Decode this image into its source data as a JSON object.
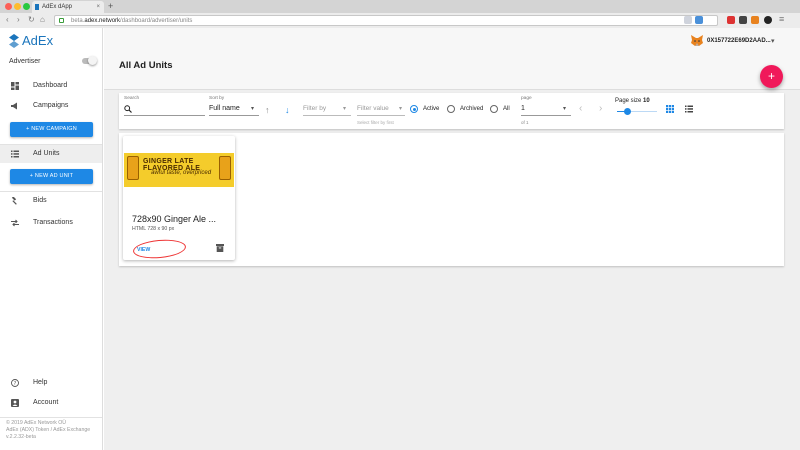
{
  "browser": {
    "tab_title": "AdEx dApp",
    "url_prefix": "beta.",
    "url_host": "adex.network",
    "url_path": "/dashboard/advertiser/units"
  },
  "sidebar": {
    "logo": "AdEx",
    "role_label": "Advertiser",
    "role_toggle_on": false,
    "items": {
      "dashboard": "Dashboard",
      "campaigns": "Campaigns",
      "new_campaign": "+ NEW CAMPAIGN",
      "ad_units": "Ad Units",
      "new_ad_unit": "+ NEW AD UNIT",
      "bids": "Bids",
      "transactions": "Transactions",
      "help": "Help",
      "account": "Account"
    },
    "footer": {
      "line1": "© 2019 AdEx Network OÜ",
      "line2": "AdEx (ADX) Token / AdEx Exchange",
      "line3": "v.2.2.32-beta"
    }
  },
  "header": {
    "account_address": "0X157722E69D2AAD...",
    "page_title": "All Ad Units",
    "add_label": "+"
  },
  "filters": {
    "search_label": "Search",
    "sort_label": "Sort by",
    "sort_value": "Full name",
    "filter_by_placeholder": "Filter by",
    "filter_value_placeholder": "Filter value",
    "filter_hint": "Select filter by first",
    "status_options": [
      "Active",
      "Archived",
      "All"
    ],
    "status_selected": "Active",
    "page_label": "page",
    "page_value": "1",
    "page_of": "of 1",
    "page_size_label": "Page size",
    "page_size_value": "10",
    "page_size_fraction": 0.25
  },
  "units": [
    {
      "title": "728x90 Ginger Ale ...",
      "subtitle": "HTML 728 x 90 px",
      "view_label": "VIEW",
      "banner_text_1": "GINGER LATE FLAVORED ALE",
      "banner_text_2": "awful taste, overpriced"
    }
  ],
  "colors": {
    "accent_blue": "#1e88e5",
    "fab_pink": "#f0195a",
    "banner_yellow": "#f4cc2b",
    "annotation_red": "#e33333"
  }
}
